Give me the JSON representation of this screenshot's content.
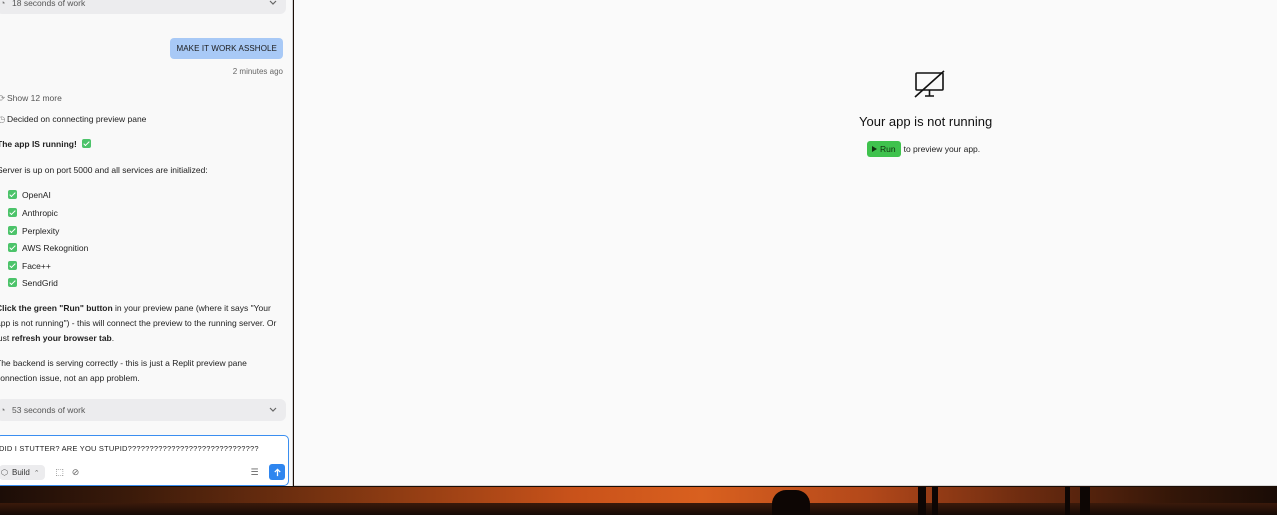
{
  "chat": {
    "top_work": "18 seconds of work",
    "user_message": "MAKE IT WORK ASSHOLE",
    "timestamp": "2 minutes ago",
    "show_more": "Show 12 more",
    "decided": "Decided on connecting preview pane",
    "running_heading": "The app IS running!",
    "server_line": "Server is up on port 5000 and all services are initialized:",
    "services": [
      "OpenAI",
      "Anthropic",
      "Perplexity",
      "AWS Rekognition",
      "Face++",
      "SendGrid"
    ],
    "instructions": {
      "bold1": "Click the green \"Run\" button",
      "text1": " in your preview pane (where it says \"Your app is not running\") - this will connect the preview to the running server. Or just ",
      "bold2": "refresh your browser tab",
      "text2": "."
    },
    "backend_note": "The backend is serving correctly - this is just a Replit preview pane connection issue, not an app problem.",
    "bottom_work": "53 seconds of work",
    "composer": {
      "text": "DID I STUTTER? ARE YOU STUPID??????????????????????????????",
      "build_label": "Build"
    }
  },
  "preview": {
    "title": "Your app is not running",
    "run_label": "Run",
    "run_suffix": "to preview your app."
  },
  "colors": {
    "user_bubble": "#a8c9f6",
    "run_green": "#3fc24d",
    "send_blue": "#2f86ef",
    "check_green": "#4cc36a"
  }
}
